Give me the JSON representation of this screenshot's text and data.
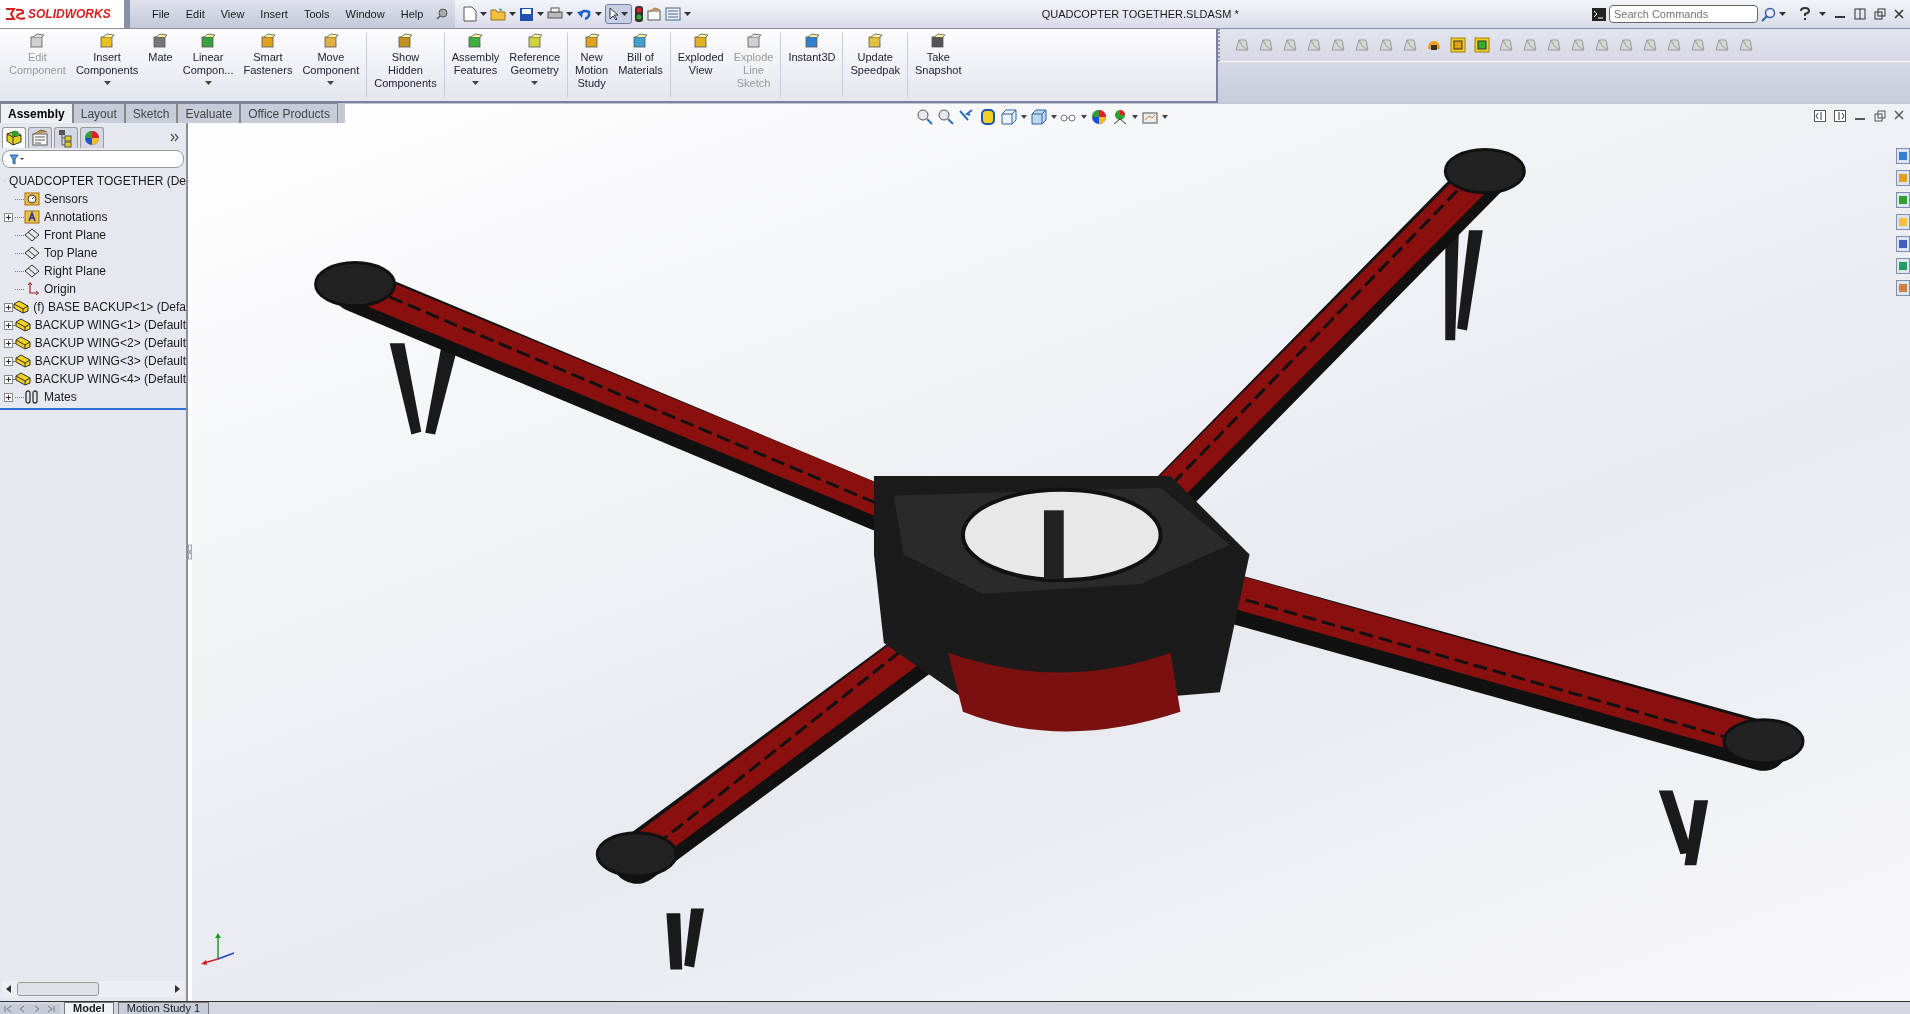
{
  "app": {
    "logo": "SOLIDWORKS"
  },
  "menu": [
    "File",
    "Edit",
    "View",
    "Insert",
    "Tools",
    "Window",
    "Help"
  ],
  "window": {
    "title": "QUADCOPTER TOGETHER.SLDASM *"
  },
  "search": {
    "placeholder": "Search Commands"
  },
  "command_groups": [
    [
      {
        "lines": [
          "Edit",
          "Component"
        ],
        "disabled": true,
        "dropdown": false
      },
      {
        "lines": [
          "Insert",
          "Components"
        ],
        "disabled": false,
        "dropdown": true
      },
      {
        "lines": [
          "Mate"
        ],
        "disabled": false,
        "dropdown": false
      },
      {
        "lines": [
          "Linear",
          "Compon..."
        ],
        "disabled": false,
        "dropdown": true
      },
      {
        "lines": [
          "Smart",
          "Fasteners"
        ],
        "disabled": false,
        "dropdown": false
      },
      {
        "lines": [
          "Move",
          "Component"
        ],
        "disabled": false,
        "dropdown": true
      }
    ],
    [
      {
        "lines": [
          "Show",
          "Hidden",
          "Components"
        ],
        "disabled": false,
        "dropdown": false
      }
    ],
    [
      {
        "lines": [
          "Assembly",
          "Features"
        ],
        "disabled": false,
        "dropdown": true
      },
      {
        "lines": [
          "Reference",
          "Geometry"
        ],
        "disabled": false,
        "dropdown": true
      }
    ],
    [
      {
        "lines": [
          "New",
          "Motion",
          "Study"
        ],
        "disabled": false,
        "dropdown": false
      },
      {
        "lines": [
          "Bill of",
          "Materials"
        ],
        "disabled": false,
        "dropdown": false
      }
    ],
    [
      {
        "lines": [
          "Exploded",
          "View"
        ],
        "disabled": false,
        "dropdown": false
      },
      {
        "lines": [
          "Explode",
          "Line",
          "Sketch"
        ],
        "disabled": true,
        "dropdown": false
      }
    ],
    [
      {
        "lines": [
          "Instant3D"
        ],
        "disabled": false,
        "dropdown": false
      }
    ],
    [
      {
        "lines": [
          "Update",
          "Speedpak"
        ],
        "disabled": false,
        "dropdown": false
      }
    ],
    [
      {
        "lines": [
          "Take",
          "Snapshot"
        ],
        "disabled": false,
        "dropdown": false
      }
    ]
  ],
  "command_tabs": [
    {
      "label": "Assembly",
      "selected": true
    },
    {
      "label": "Layout",
      "selected": false
    },
    {
      "label": "Sketch",
      "selected": false
    },
    {
      "label": "Evaluate",
      "selected": false
    },
    {
      "label": "Office Products",
      "selected": false
    }
  ],
  "feature_tree": {
    "root": "QUADCOPTER TOGETHER  (De",
    "children": [
      {
        "kind": "sensors",
        "label": "Sensors",
        "expandable": false
      },
      {
        "kind": "annotations",
        "label": "Annotations",
        "expandable": true
      },
      {
        "kind": "plane",
        "label": "Front Plane",
        "expandable": false
      },
      {
        "kind": "plane",
        "label": "Top Plane",
        "expandable": false
      },
      {
        "kind": "plane",
        "label": "Right Plane",
        "expandable": false
      },
      {
        "kind": "origin",
        "label": "Origin",
        "expandable": false
      },
      {
        "kind": "component",
        "label": "(f) BASE BACKUP<1>  (Defa",
        "expandable": true
      },
      {
        "kind": "component",
        "label": "BACKUP WING<1>  (Default",
        "expandable": true
      },
      {
        "kind": "component",
        "label": "BACKUP WING<2>  (Default",
        "expandable": true
      },
      {
        "kind": "component",
        "label": "BACKUP WING<3>  (Default",
        "expandable": true
      },
      {
        "kind": "component",
        "label": "BACKUP WING<4>  (Default",
        "expandable": true
      },
      {
        "kind": "mates",
        "label": "Mates",
        "expandable": true
      }
    ]
  },
  "bottom_tabs": [
    {
      "label": "Model",
      "selected": true
    },
    {
      "label": "Motion Study 1",
      "selected": false
    }
  ]
}
